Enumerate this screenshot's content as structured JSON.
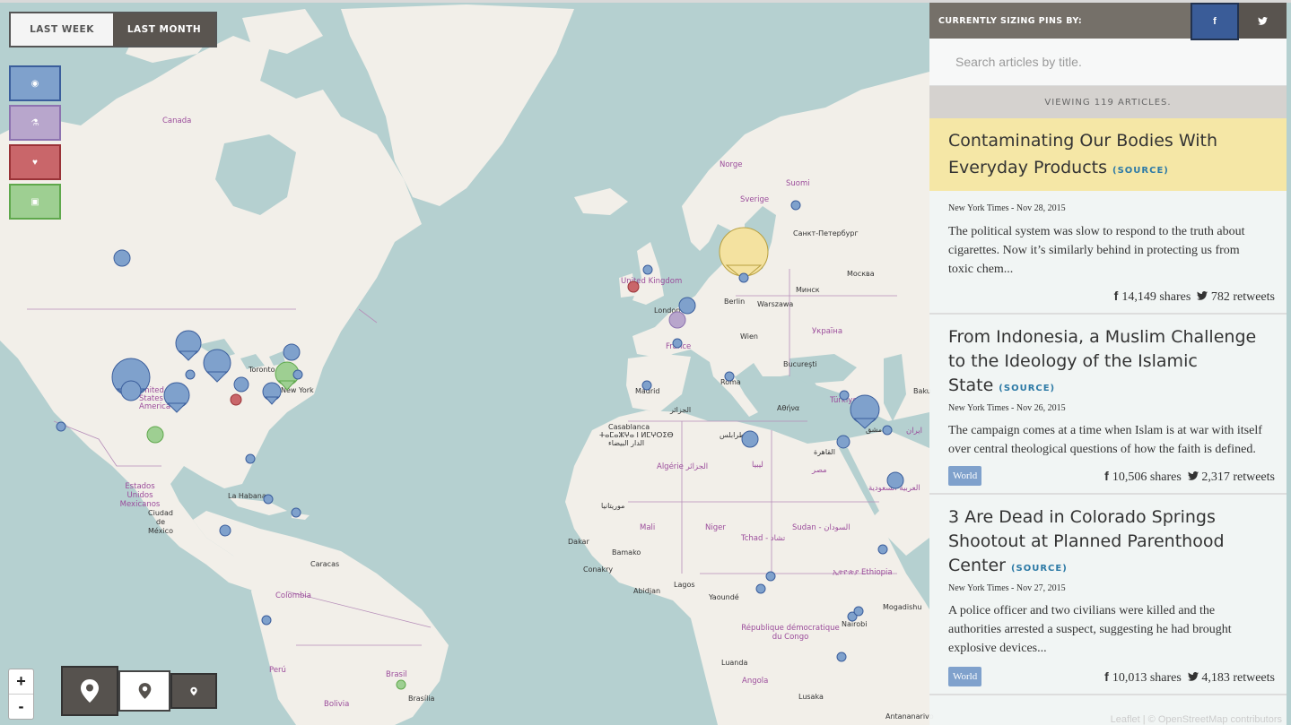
{
  "range_toggle": {
    "last_week": "LAST WEEK",
    "last_month": "LAST MONTH",
    "active": "last_month"
  },
  "categories": [
    {
      "name": "world",
      "icon": "globe-icon",
      "glyph": "◉",
      "color": "#7fa1cc",
      "border": "#3b5e9c"
    },
    {
      "name": "science",
      "icon": "flask-icon",
      "glyph": "⚗",
      "color": "#b8a6cc",
      "border": "#8d73b0"
    },
    {
      "name": "health",
      "icon": "heartbeat-icon",
      "glyph": "♥",
      "color": "#c9666a",
      "border": "#9a3237"
    },
    {
      "name": "money",
      "icon": "money-icon",
      "glyph": "▣",
      "color": "#9ecf92",
      "border": "#5fa84c"
    }
  ],
  "zoom": {
    "in": "+",
    "out": "-"
  },
  "map_labels": {
    "countries": [
      "Canada",
      "Norge",
      "Sverige",
      "Suomi",
      "United Kingdom",
      "France",
      "Україна",
      "United States of America",
      "Estados Unidos Mexicanos",
      "Algérie الجزائر",
      "Mali",
      "Niger",
      "Tchad - تشاد",
      "Sudan - السودان",
      "ليبيا",
      "مصر",
      "Türkiye",
      "ایران",
      "العربية السعودية",
      "ኢትዮጵያ Ethiopia",
      "République démocratique du Congo",
      "Angola",
      "Colombia",
      "Perú",
      "Brasil",
      "Bolivia",
      "Україна"
    ],
    "cities": [
      "Санкт-Петербург",
      "Москва",
      "Минск",
      "Berlin",
      "Warszawa",
      "London",
      "Wien",
      "Bucureşti",
      "Madrid",
      "Roma",
      "Αθήνα",
      "Baku",
      "الجزائر",
      "Casablanca",
      "ⵜⴰⵎⴰⵣⵖⴰ ⵏ ⵍⵎⵖⵔⵉⴱ",
      "الدار البيضاء",
      "طرابلس",
      "القاهرة",
      "دمشق",
      "Toronto",
      "New York",
      "La Habana",
      "Ciudad de México",
      "Caracas",
      "Dakar",
      "Bamako",
      "Conakry",
      "Abidjan",
      "Lagos",
      "Yaoundé",
      "Mogadishu",
      "Nairobi",
      "Luanda",
      "Lusaka",
      "Brasília",
      "Antananarivo",
      "موريتانيا"
    ]
  },
  "pin_size": {
    "large": "large-pin-icon",
    "medium": "medium-pin-icon",
    "small": "small-pin-icon"
  },
  "sidebar": {
    "header_label": "CURRENTLY SIZING PINS BY:",
    "facebook_glyph": "f",
    "twitter_glyph": "🐦",
    "search_placeholder": "Search articles by title.",
    "count_text": "VIEWING 119 ARTICLES.",
    "source_label": "(SOURCE)",
    "articles": [
      {
        "title": "Contaminating Our Bodies With Everyday Products",
        "meta": "New York Times - Nov 28, 2015",
        "desc": "The political system was slow to respond to the truth about cigarettes. Now it’s similarly behind in protecting us from toxic chem...",
        "tag": "",
        "shares": "14,149 shares",
        "retweets": "782 retweets",
        "highlight": true
      },
      {
        "title": "From Indonesia, a Muslim Challenge to the Ideology of the Islamic State",
        "meta": "New York Times - Nov 26, 2015",
        "desc": "The campaign comes at a time when Islam is at war with itself over central theological questions of how the faith is defined.",
        "tag": "World",
        "shares": "10,506 shares",
        "retweets": "2,317 retweets",
        "highlight": false
      },
      {
        "title": "3 Are Dead in Colorado Springs Shootout at Planned Parenthood Center",
        "meta": "New York Times - Nov 27, 2015",
        "desc": "A police officer and two civilians were killed and the authorities arrested a suspect, suggesting he had brought explosive devices...",
        "tag": "World",
        "shares": "10,013 shares",
        "retweets": "4,183 retweets",
        "highlight": false
      }
    ]
  },
  "attribution": "Leaflet | © OpenStreetMap contributors"
}
